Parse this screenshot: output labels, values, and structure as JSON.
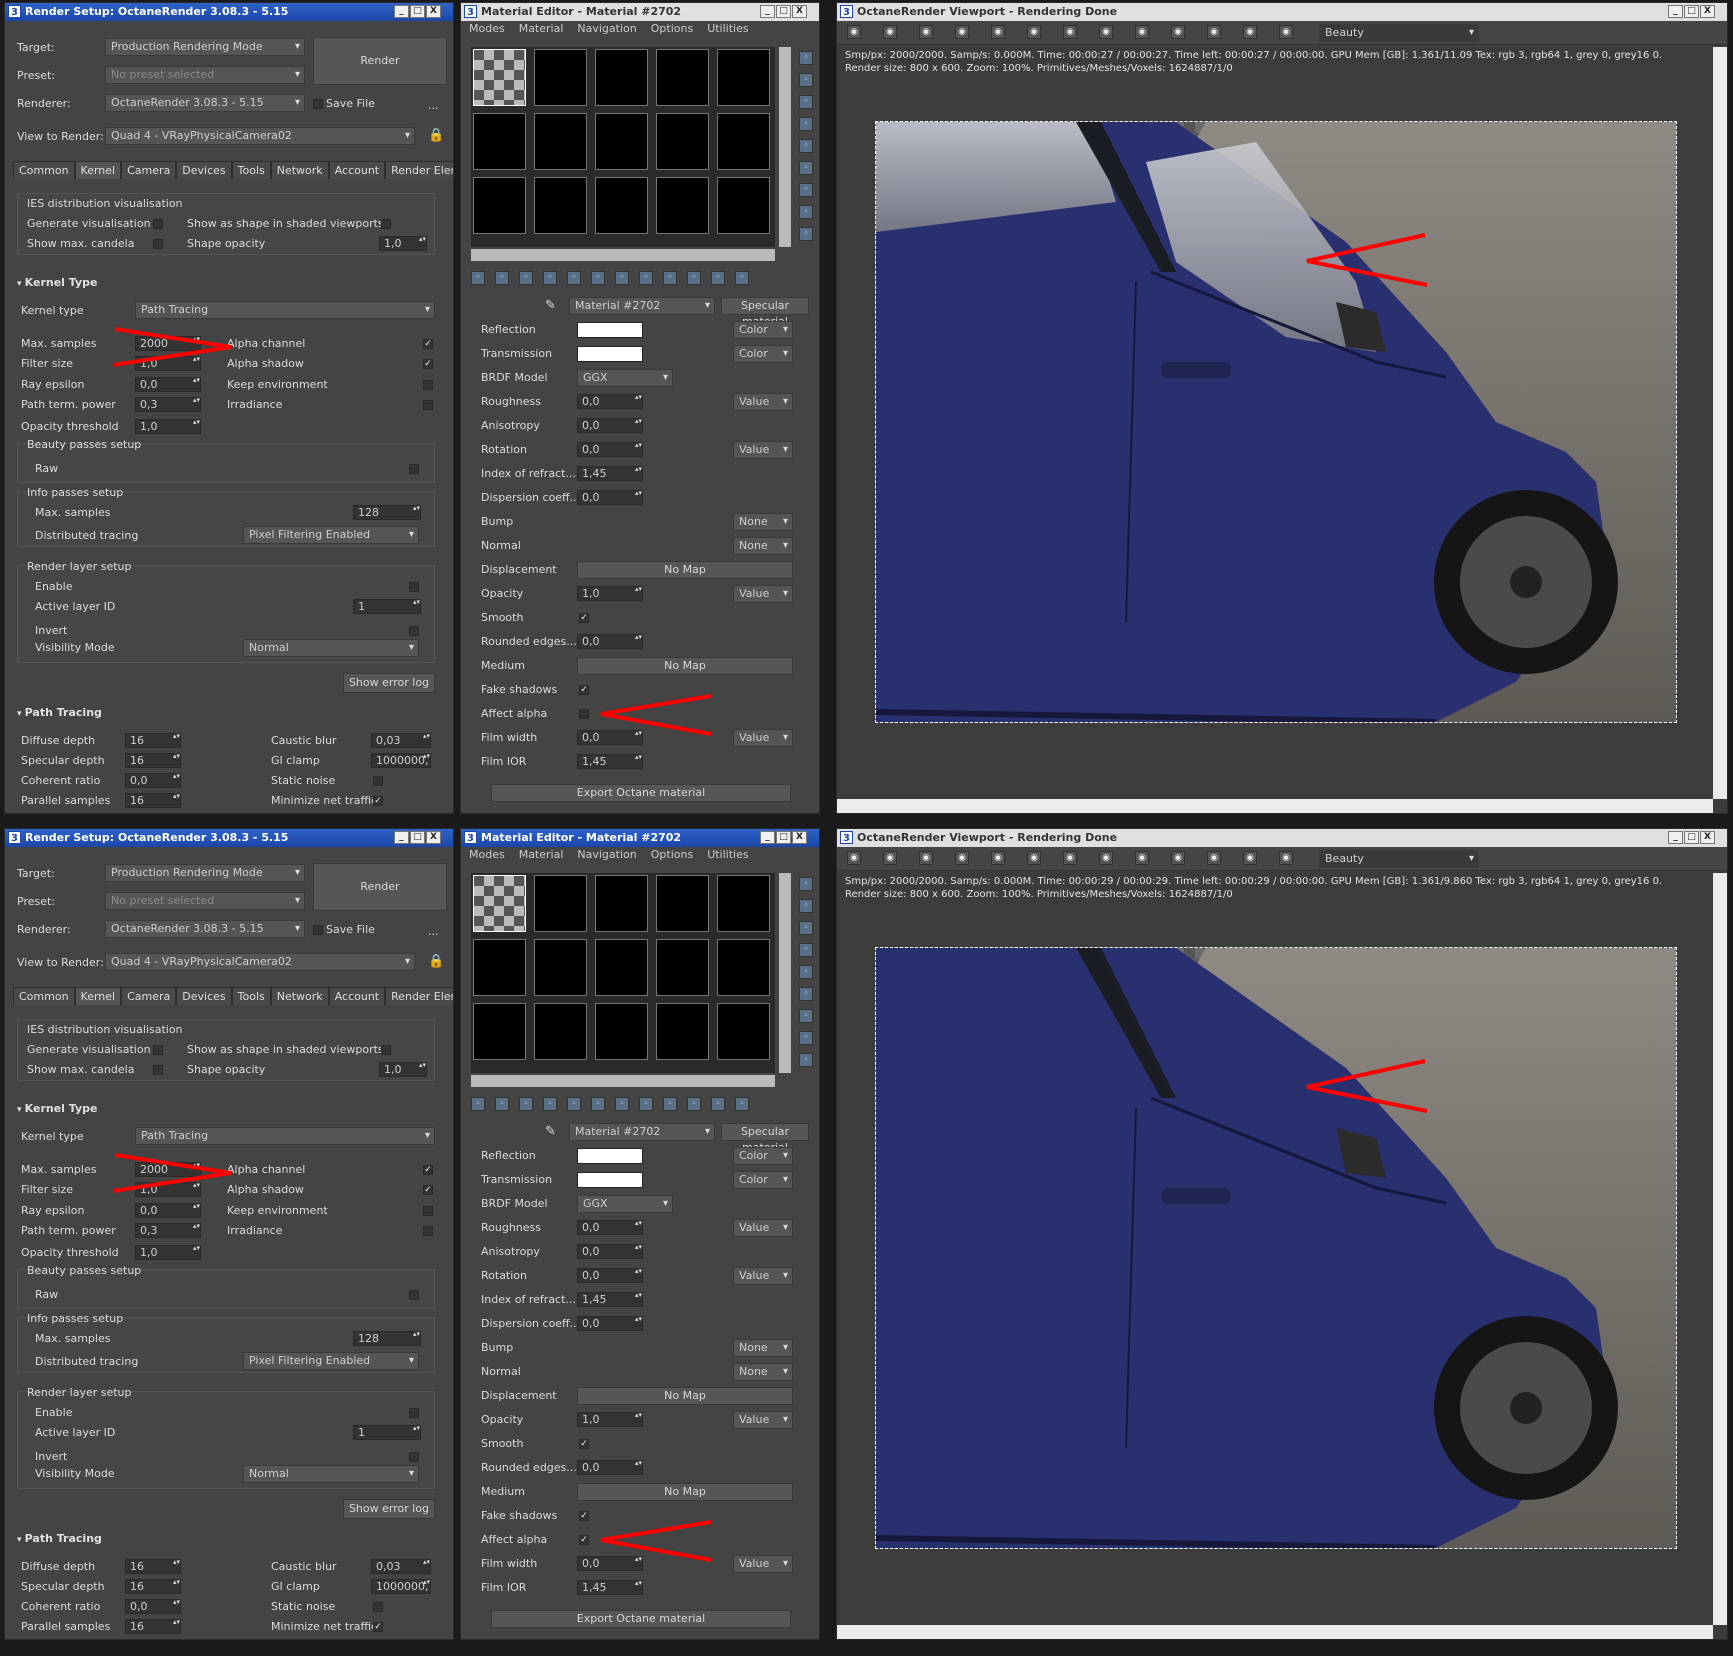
{
  "rs": {
    "title": "Render Setup: OctaneRender 3.08.3 - 5.15",
    "target_label": "Target:",
    "target": "Production Rendering Mode",
    "preset_label": "Preset:",
    "preset": "No preset selected",
    "renderer_label": "Renderer:",
    "renderer": "OctaneRender 3.08.3 - 5.15",
    "save_file": "Save File",
    "more": "...",
    "view_label": "View to Render:",
    "view": "Quad 4 - VRayPhysicalCamera02",
    "render_btn": "Render",
    "tabs": [
      "Common",
      "Kernel",
      "Camera",
      "Devices",
      "Tools",
      "Network",
      "Account",
      "Render Elements"
    ],
    "ies": {
      "title": "IES distribution visualisation",
      "gen": "Generate visualisation",
      "shape": "Show as shape in shaded viewports",
      "maxc": "Show max. candela",
      "opacity": "Shape opacity",
      "opacity_val": "1,0"
    },
    "kernel": {
      "title": "Kernel Type",
      "type_label": "Kernel type",
      "type": "Path Tracing",
      "max_samples": "Max. samples",
      "max_samples_val": "2000",
      "filter": "Filter size",
      "filter_val": "1,0",
      "ray_eps": "Ray epsilon",
      "ray_eps_val": "0,0",
      "pathterm": "Path term. power",
      "pathterm_val": "0,3",
      "opac": "Opacity threshold",
      "opac_val": "1,0",
      "alpha": "Alpha channel",
      "alpha_shadow": "Alpha shadow",
      "keep_env": "Keep environment",
      "irr": "Irradiance",
      "beauty": "Beauty passes setup",
      "raw": "Raw",
      "info": "Info passes setup",
      "info_max": "Max. samples",
      "info_max_val": "128",
      "dist": "Distributed tracing",
      "dist_val": "Pixel Filtering Enabled",
      "layer": "Render layer setup",
      "enable": "Enable",
      "active": "Active layer ID",
      "active_val": "1",
      "invert": "Invert",
      "vis": "Visibility Mode",
      "vis_val": "Normal",
      "err_btn": "Show error log"
    },
    "pt": {
      "title": "Path Tracing",
      "diff": "Diffuse depth",
      "diff_val": "16",
      "spec": "Specular depth",
      "spec_val": "16",
      "coh": "Coherent ratio",
      "coh_val": "0,0",
      "par": "Parallel samples",
      "par_val": "16",
      "caustic": "Caustic blur",
      "caustic_val": "0,03",
      "gi": "GI clamp",
      "gi_val": "1000000,",
      "static": "Static noise",
      "minnet": "Minimize net traffic"
    }
  },
  "me": {
    "title": "Material Editor - Material #2702",
    "menu": [
      "Modes",
      "Material",
      "Navigation",
      "Options",
      "Utilities"
    ],
    "mat": "Material #2702",
    "mtype": "Specular material",
    "params": [
      {
        "label": "Reflection",
        "kind": "swatch",
        "side": "Color"
      },
      {
        "label": "Transmission",
        "kind": "swatch",
        "side": "Color"
      },
      {
        "label": "BRDF Model",
        "kind": "dd",
        "val": "GGX"
      },
      {
        "label": "Roughness",
        "kind": "spin",
        "val": "0,0",
        "side": "Value"
      },
      {
        "label": "Anisotropy",
        "kind": "spin",
        "val": "0,0"
      },
      {
        "label": "Rotation",
        "kind": "spin",
        "val": "0,0",
        "side": "Value"
      },
      {
        "label": "Index of refract...",
        "kind": "spin",
        "val": "1,45"
      },
      {
        "label": "Dispersion coeff...",
        "kind": "spin",
        "val": "0,0"
      },
      {
        "label": "Bump",
        "kind": "none",
        "side": "None"
      },
      {
        "label": "Normal",
        "kind": "none",
        "side": "None"
      },
      {
        "label": "Displacement",
        "kind": "nomap",
        "val": "No Map"
      },
      {
        "label": "Opacity",
        "kind": "spin",
        "val": "1,0",
        "side": "Value"
      },
      {
        "label": "Smooth",
        "kind": "chk",
        "checked": true
      },
      {
        "label": "Rounded edges...",
        "kind": "spin",
        "val": "0,0"
      },
      {
        "label": "Medium",
        "kind": "nomap",
        "val": "No Map"
      },
      {
        "label": "Fake shadows",
        "kind": "chk",
        "checked": true
      },
      {
        "label": "Affect alpha",
        "kind": "chk",
        "checked": false
      },
      {
        "label": "Film width",
        "kind": "spin",
        "val": "0,0",
        "side": "Value"
      },
      {
        "label": "Film IOR",
        "kind": "spin",
        "val": "1,45"
      }
    ],
    "export": "Export Octane material"
  },
  "vp": {
    "title": "OctaneRender Viewport - Rendering Done",
    "pass": "Beauty",
    "stats_top": [
      "Smp/px: 2000/2000.   Samp/s: 0.000M.   Time: 00:00:27 / 00:00:27.   Time left: 00:00:27 / 00:00:00.   GPU Mem [GB]: 1.361/11.09   Tex: rgb 3, rgb64 1, grey 0, grey16 0.",
      "Render size: 800 x 600.   Zoom: 100%.   Primitives/Meshes/Voxels: 1624887/1/0"
    ],
    "stats_bottom": [
      "Smp/px: 2000/2000.   Samp/s: 0.000M.   Time: 00:00:29 / 00:00:29.   Time left: 00:00:29 / 00:00:00.   GPU Mem [GB]: 1.361/9.860   Tex: rgb 3, rgb64 1, grey 0, grey16 0.",
      "Render size: 800 x 600.   Zoom: 100%.   Primitives/Meshes/Voxels: 1624887/1/0"
    ]
  },
  "colors": {
    "accent": "#2f63c8",
    "car": "#28306f",
    "annot": "#ff0000"
  }
}
